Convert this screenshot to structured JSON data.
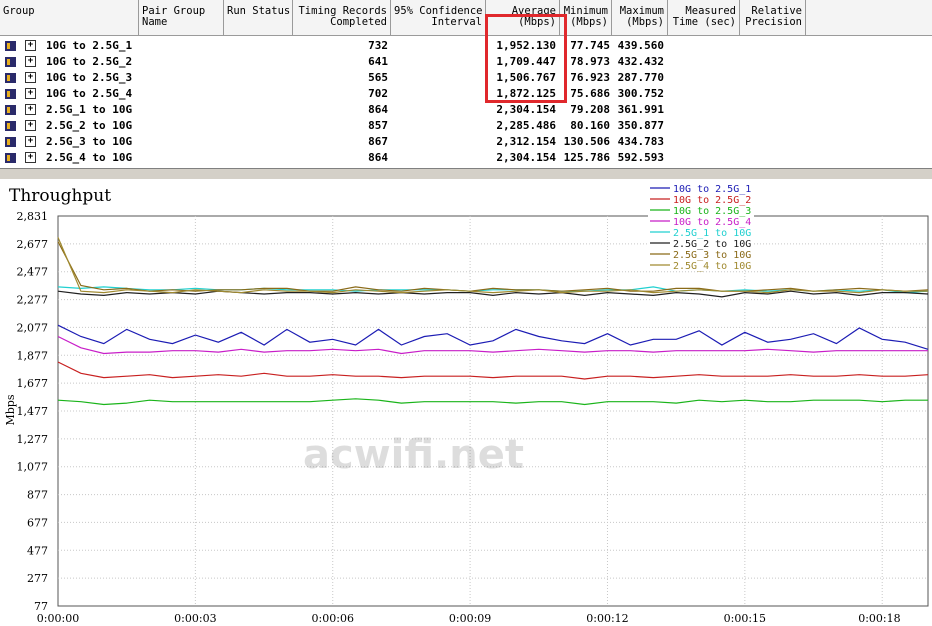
{
  "table": {
    "headers": [
      {
        "l1": "",
        "l2": "Group"
      },
      {
        "l1": "Pair Group",
        "l2": "Name"
      },
      {
        "l1": "",
        "l2": "Run Status"
      },
      {
        "l1": "Timing Records",
        "l2": "Completed"
      },
      {
        "l1": "95% Confidence",
        "l2": "Interval"
      },
      {
        "l1": "Average",
        "l2": "(Mbps)"
      },
      {
        "l1": "Minimum",
        "l2": "(Mbps)"
      },
      {
        "l1": "Maximum",
        "l2": "(Mbps)"
      },
      {
        "l1": "Measured",
        "l2": "Time (sec)"
      },
      {
        "l1": "Relative",
        "l2": "Precision"
      }
    ],
    "rows": [
      {
        "group": "10G to 2.5G_1",
        "records": "732",
        "avg": "1,952.130",
        "min": "77.745",
        "max": "439.560"
      },
      {
        "group": "10G to 2.5G_2",
        "records": "641",
        "avg": "1,709.447",
        "min": "78.973",
        "max": "432.432"
      },
      {
        "group": "10G to 2.5G_3",
        "records": "565",
        "avg": "1,506.767",
        "min": "76.923",
        "max": "287.770"
      },
      {
        "group": "10G to 2.5G_4",
        "records": "702",
        "avg": "1,872.125",
        "min": "75.686",
        "max": "300.752"
      },
      {
        "group": "2.5G_1 to 10G",
        "records": "864",
        "avg": "2,304.154",
        "min": "79.208",
        "max": "361.991"
      },
      {
        "group": "2.5G_2 to 10G",
        "records": "857",
        "avg": "2,285.486",
        "min": "80.160",
        "max": "350.877"
      },
      {
        "group": "2.5G_3 to 10G",
        "records": "867",
        "avg": "2,312.154",
        "min": "130.506",
        "max": "434.783"
      },
      {
        "group": "2.5G_4 to 10G",
        "records": "864",
        "avg": "2,304.154",
        "min": "125.786",
        "max": "592.593"
      }
    ]
  },
  "watermark": "acwifi.net",
  "chart_data": {
    "type": "line",
    "title": "Throughput",
    "ylabel": "Mbps",
    "xlabel": "",
    "yticks": [
      "2,831",
      "2,677",
      "2,477",
      "2,277",
      "2,077",
      "1,877",
      "1,677",
      "1,477",
      "1,277",
      "1,077",
      "877",
      "677",
      "477",
      "277",
      "77"
    ],
    "xticks": [
      "0:00:00",
      "0:00:03",
      "0:00:06",
      "0:00:09",
      "0:00:12",
      "0:00:15",
      "0:00:18"
    ],
    "ylim": [
      77,
      2831
    ],
    "xlim_sec": [
      0,
      19
    ],
    "grid": true,
    "legend_position": "top-right",
    "series": [
      {
        "name": "10G to 2.5G_1",
        "color": "#1c1cb4",
        "x": [
          0,
          0.5,
          1,
          1.5,
          2,
          2.5,
          3,
          3.5,
          4,
          4.5,
          5,
          5.5,
          6,
          6.5,
          7,
          7.5,
          8,
          8.5,
          9,
          9.5,
          10,
          10.5,
          11,
          11.5,
          12,
          12.5,
          13,
          13.5,
          14,
          14.5,
          15,
          15.5,
          16,
          16.5,
          17,
          17.5,
          18,
          18.5,
          19
        ],
        "y": [
          2060,
          1980,
          1930,
          2030,
          1960,
          1930,
          1990,
          1940,
          2010,
          1920,
          2030,
          1940,
          1960,
          1920,
          2030,
          1920,
          1980,
          2000,
          1920,
          1950,
          2030,
          1980,
          1950,
          1930,
          2000,
          1920,
          1960,
          1960,
          2020,
          1920,
          2010,
          1940,
          1960,
          2000,
          1930,
          2040,
          1960,
          1940,
          1890
        ]
      },
      {
        "name": "10G to 2.5G_2",
        "color": "#c82020",
        "x": [
          0,
          0.5,
          1,
          1.5,
          2,
          2.5,
          3,
          3.5,
          4,
          4.5,
          5,
          5.5,
          6,
          6.5,
          7,
          7.5,
          8,
          8.5,
          9,
          9.5,
          10,
          10.5,
          11,
          11.5,
          12,
          12.5,
          13,
          13.5,
          14,
          14.5,
          15,
          15.5,
          16,
          16.5,
          17,
          17.5,
          18,
          18.5,
          19
        ],
        "y": [
          1800,
          1720,
          1690,
          1700,
          1710,
          1690,
          1700,
          1710,
          1700,
          1720,
          1700,
          1700,
          1710,
          1700,
          1700,
          1690,
          1700,
          1700,
          1700,
          1690,
          1700,
          1700,
          1700,
          1680,
          1700,
          1700,
          1690,
          1700,
          1710,
          1700,
          1700,
          1700,
          1710,
          1700,
          1700,
          1710,
          1700,
          1700,
          1710
        ]
      },
      {
        "name": "10G to 2.5G_3",
        "color": "#1ab41a",
        "x": [
          0,
          0.5,
          1,
          1.5,
          2,
          2.5,
          3,
          3.5,
          4,
          4.5,
          5,
          5.5,
          6,
          6.5,
          7,
          7.5,
          8,
          8.5,
          9,
          9.5,
          10,
          10.5,
          11,
          11.5,
          12,
          12.5,
          13,
          13.5,
          14,
          14.5,
          15,
          15.5,
          16,
          16.5,
          17,
          17.5,
          18,
          18.5,
          19
        ],
        "y": [
          1530,
          1520,
          1500,
          1510,
          1530,
          1520,
          1520,
          1520,
          1520,
          1520,
          1520,
          1520,
          1530,
          1540,
          1530,
          1510,
          1520,
          1520,
          1520,
          1520,
          1510,
          1520,
          1520,
          1500,
          1520,
          1520,
          1520,
          1510,
          1530,
          1520,
          1530,
          1520,
          1520,
          1530,
          1530,
          1530,
          1520,
          1530,
          1530
        ]
      },
      {
        "name": "10G to 2.5G_4",
        "color": "#c81ec8",
        "x": [
          0,
          0.5,
          1,
          1.5,
          2,
          2.5,
          3,
          3.5,
          4,
          4.5,
          5,
          5.5,
          6,
          6.5,
          7,
          7.5,
          8,
          8.5,
          9,
          9.5,
          10,
          10.5,
          11,
          11.5,
          12,
          12.5,
          13,
          13.5,
          14,
          14.5,
          15,
          15.5,
          16,
          16.5,
          17,
          17.5,
          18,
          18.5,
          19
        ],
        "y": [
          1980,
          1900,
          1860,
          1870,
          1870,
          1880,
          1880,
          1870,
          1890,
          1870,
          1880,
          1880,
          1890,
          1880,
          1890,
          1860,
          1880,
          1880,
          1880,
          1870,
          1880,
          1890,
          1880,
          1870,
          1880,
          1880,
          1870,
          1880,
          1880,
          1880,
          1880,
          1890,
          1880,
          1870,
          1880,
          1880,
          1880,
          1880,
          1880
        ]
      },
      {
        "name": "2.5G_1 to 10G",
        "color": "#20d0d0",
        "x": [
          0,
          0.5,
          1,
          1.5,
          2,
          2.5,
          3,
          3.5,
          4,
          4.5,
          5,
          5.5,
          6,
          6.5,
          7,
          7.5,
          8,
          8.5,
          9,
          9.5,
          10,
          10.5,
          11,
          11.5,
          12,
          12.5,
          13,
          13.5,
          14,
          14.5,
          15,
          15.5,
          16,
          16.5,
          17,
          17.5,
          18,
          18.5,
          19
        ],
        "y": [
          2330,
          2320,
          2330,
          2320,
          2310,
          2310,
          2320,
          2310,
          2310,
          2320,
          2310,
          2310,
          2310,
          2300,
          2310,
          2310,
          2310,
          2310,
          2300,
          2310,
          2310,
          2310,
          2300,
          2300,
          2310,
          2310,
          2330,
          2300,
          2310,
          2300,
          2310,
          2300,
          2310,
          2300,
          2310,
          2300,
          2310,
          2290,
          2300
        ]
      },
      {
        "name": "2.5G_2 to 10G",
        "color": "#202020",
        "x": [
          0,
          0.5,
          1,
          1.5,
          2,
          2.5,
          3,
          3.5,
          4,
          4.5,
          5,
          5.5,
          6,
          6.5,
          7,
          7.5,
          8,
          8.5,
          9,
          9.5,
          10,
          10.5,
          11,
          11.5,
          12,
          12.5,
          13,
          13.5,
          14,
          14.5,
          15,
          15.5,
          16,
          16.5,
          17,
          17.5,
          18,
          18.5,
          19
        ],
        "y": [
          2300,
          2280,
          2270,
          2290,
          2280,
          2290,
          2280,
          2300,
          2290,
          2280,
          2290,
          2290,
          2280,
          2290,
          2280,
          2290,
          2280,
          2290,
          2290,
          2270,
          2290,
          2280,
          2290,
          2270,
          2290,
          2280,
          2270,
          2290,
          2280,
          2260,
          2290,
          2280,
          2300,
          2280,
          2290,
          2270,
          2290,
          2290,
          2280
        ]
      },
      {
        "name": "2.5G_3 to 10G",
        "color": "#8a6a18",
        "x": [
          0,
          0.5,
          1,
          1.5,
          2,
          2.5,
          3,
          3.5,
          4,
          4.5,
          5,
          5.5,
          6,
          6.5,
          7,
          7.5,
          8,
          8.5,
          9,
          9.5,
          10,
          10.5,
          11,
          11.5,
          12,
          12.5,
          13,
          13.5,
          14,
          14.5,
          15,
          15.5,
          16,
          16.5,
          17,
          17.5,
          18,
          18.5,
          19
        ],
        "y": [
          2650,
          2340,
          2310,
          2320,
          2300,
          2310,
          2300,
          2310,
          2310,
          2320,
          2320,
          2300,
          2300,
          2330,
          2310,
          2300,
          2320,
          2310,
          2300,
          2320,
          2310,
          2310,
          2300,
          2310,
          2320,
          2300,
          2300,
          2320,
          2320,
          2300,
          2300,
          2310,
          2320,
          2300,
          2310,
          2320,
          2310,
          2300,
          2310
        ]
      },
      {
        "name": "2.5G_4 to 10G",
        "color": "#a08a30",
        "x": [
          0,
          0.5,
          1,
          1.5,
          2,
          2.5,
          3,
          3.5,
          4,
          4.5,
          5,
          5.5,
          6,
          6.5,
          7,
          7.5,
          8,
          8.5,
          9,
          9.5,
          10,
          10.5,
          11,
          11.5,
          12,
          12.5,
          13,
          13.5,
          14,
          14.5,
          15,
          15.5,
          16,
          16.5,
          17,
          17.5,
          18,
          18.5,
          19
        ],
        "y": [
          2680,
          2300,
          2290,
          2310,
          2300,
          2290,
          2310,
          2300,
          2290,
          2310,
          2300,
          2300,
          2290,
          2310,
          2300,
          2290,
          2300,
          2310,
          2300,
          2290,
          2300,
          2310,
          2290,
          2300,
          2300,
          2310,
          2290,
          2300,
          2310,
          2300,
          2300,
          2290,
          2310,
          2300,
          2300,
          2290,
          2310,
          2300,
          2300
        ]
      }
    ]
  }
}
